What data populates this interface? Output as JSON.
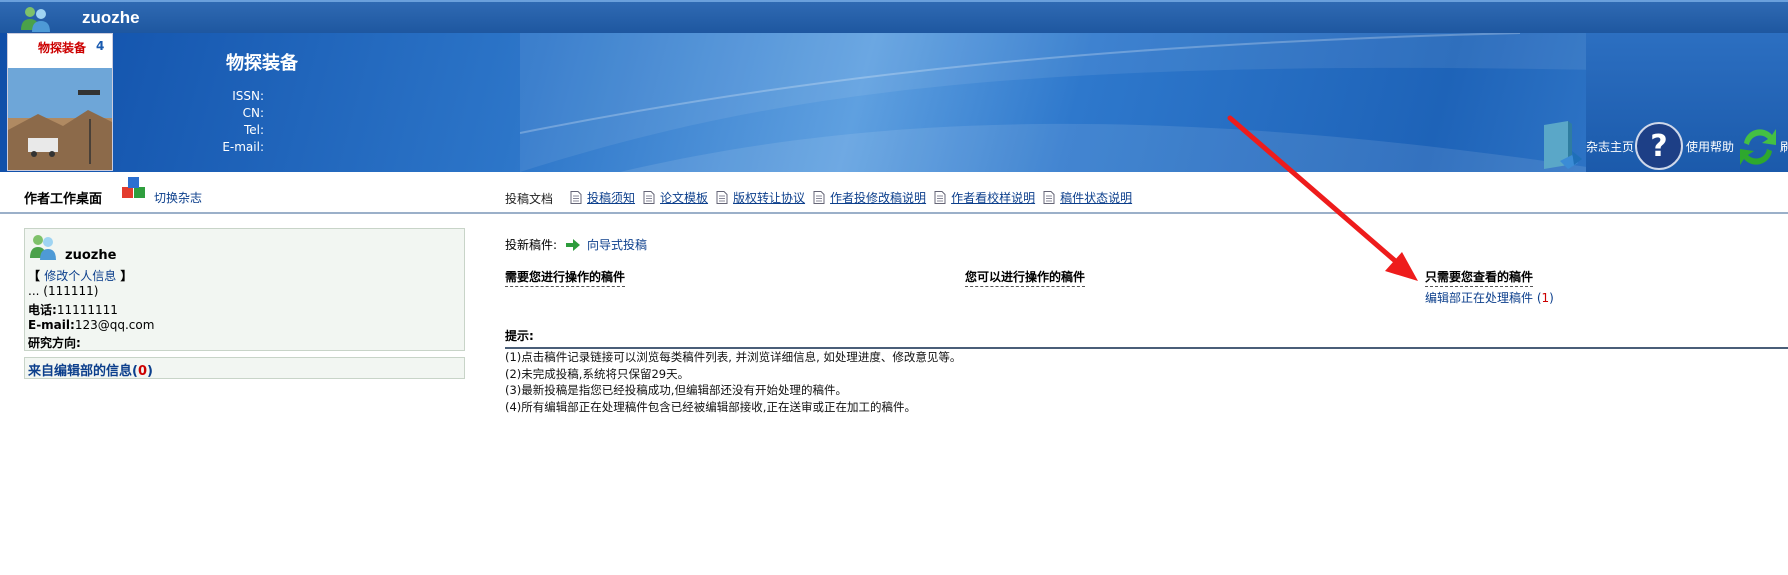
{
  "topbar": {
    "username": "zuozhe"
  },
  "banner": {
    "journal_title": "物探装备",
    "meta": [
      {
        "label": "ISSN:",
        "value": ""
      },
      {
        "label": "CN:",
        "value": ""
      },
      {
        "label": "Tel:",
        "value": ""
      },
      {
        "label": "E-mail:",
        "value": ""
      }
    ],
    "cover": {
      "logo_text": "物探装备",
      "issue": "4"
    },
    "buttons": [
      {
        "label": "杂志主页",
        "icon": "journal-home-icon"
      },
      {
        "label": "使用帮助",
        "icon": "help-icon"
      },
      {
        "label": "刷",
        "icon": "refresh-icon"
      }
    ]
  },
  "nav": {
    "desk_title": "作者工作桌面",
    "switch_label": "切换杂志",
    "docs_label": "投稿文档",
    "doc_links": [
      "投稿须知",
      "论文模板",
      "版权转让协议",
      "作者投修改稿说明",
      "作者看校样说明",
      "稿件状态说明"
    ]
  },
  "profile": {
    "name": "zuozhe",
    "edit_open": "【",
    "edit_label": "修改个人信息",
    "edit_close": "】",
    "affiliation": "... (111111)",
    "phone_label": "电话:",
    "phone": "11111111",
    "email_label": "E-mail:",
    "email": "123@qq.com",
    "research_label": "研究方向:",
    "research": ""
  },
  "messages": {
    "label": "来自编辑部的信息(",
    "count": "0",
    "close": ")"
  },
  "main": {
    "new_sub_label": "投新稿件:",
    "wizard_label": "向导式投稿",
    "col_headers": [
      "需要您进行操作的稿件",
      "您可以进行操作的稿件",
      "只需要您查看的稿件"
    ],
    "editing_label": "编辑部正在处理稿件 (",
    "editing_count": "1",
    "editing_close": ")",
    "tips_title": "提示:",
    "tips": [
      "(1)点击稿件记录链接可以浏览每类稿件列表, 并浏览详细信息, 如处理进度、修改意见等。",
      "(2)未完成投稿,系统将只保留29天。",
      "(3)最新投稿是指您已经投稿成功,但编辑部还没有开始处理的稿件。",
      "(4)所有编辑部正在处理稿件包含已经被编辑部接收,正在送审或正在加工的稿件。"
    ]
  },
  "colors": {
    "accent_blue": "#1e57a0",
    "link": "#0c3f8c",
    "count_red": "#cc0000",
    "annotation_red": "#ee1c1c"
  }
}
